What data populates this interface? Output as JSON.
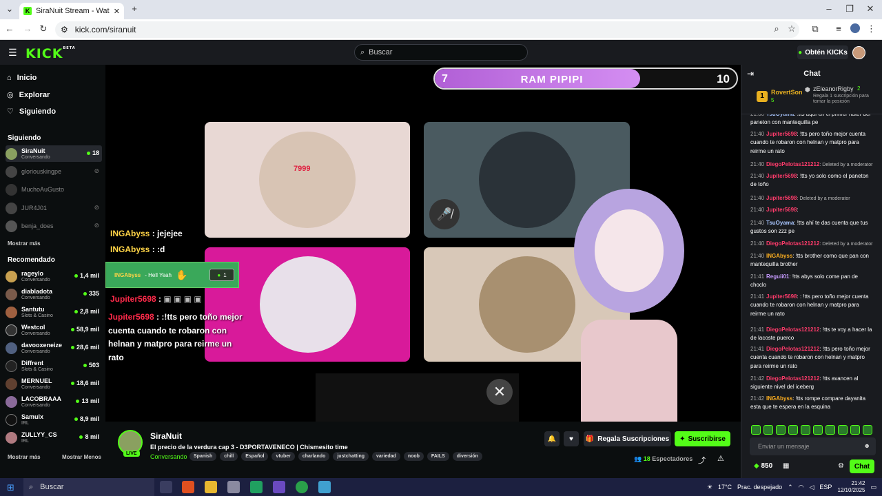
{
  "browser": {
    "tab_title": "SiraNuit Stream - Watch Live o",
    "url": "kick.com/siranuit"
  },
  "header": {
    "logo": "KICK",
    "logo_badge": "BETA",
    "search_placeholder": "Buscar",
    "kicks_button": "Obtén KICKs"
  },
  "sidebar": {
    "nav": [
      {
        "label": "Inicio",
        "icon": "home-icon"
      },
      {
        "label": "Explorar",
        "icon": "compass-icon"
      },
      {
        "label": "Siguiendo",
        "icon": "heart-icon"
      }
    ],
    "following_title": "Siguiendo",
    "following": [
      {
        "name": "SiraNuit",
        "category": "Conversando",
        "viewers": "18",
        "live": true
      },
      {
        "name": "gloriouskingpe",
        "category": "",
        "viewers": "",
        "live": false
      },
      {
        "name": "MuchoAuGusto",
        "category": "",
        "viewers": "",
        "live": false
      },
      {
        "name": "JUR4J01",
        "category": "",
        "viewers": "",
        "live": false
      },
      {
        "name": "benja_does",
        "category": "",
        "viewers": "",
        "live": false
      }
    ],
    "show_more_following": "Mostrar más",
    "recommended_title": "Recomendado",
    "recommended": [
      {
        "name": "rageylo",
        "category": "Conversando",
        "viewers": "1,4 mil"
      },
      {
        "name": "diabladota",
        "category": "Conversando",
        "viewers": "335"
      },
      {
        "name": "Santutu",
        "category": "Slots & Casino",
        "viewers": "2,8 mil"
      },
      {
        "name": "Westcol",
        "category": "Conversando",
        "viewers": "58,9 mil"
      },
      {
        "name": "davooxeneize",
        "category": "Conversando",
        "viewers": "28,6 mil"
      },
      {
        "name": "Diffrent",
        "category": "Slots & Casino",
        "viewers": "503"
      },
      {
        "name": "MERNUEL",
        "category": "Conversando",
        "viewers": "18,6 mil"
      },
      {
        "name": "LACOBRAAA",
        "category": "Conversando",
        "viewers": "13 mil"
      },
      {
        "name": "Samulx",
        "category": "IRL",
        "viewers": "8,9 mil"
      },
      {
        "name": "ZULLYY_CS",
        "category": "IRL",
        "viewers": "8 mil"
      }
    ],
    "show_more": "Mostrar más",
    "show_less": "Mostrar Menos"
  },
  "video": {
    "bar_left": "7",
    "bar_title": "RAM PIPIPI",
    "bar_right": "10",
    "bar_progress": 0.68,
    "tile_number": "7999",
    "overlay_lines": [
      {
        "user": "INGAbyss",
        "text": " : jejejee"
      },
      {
        "user": "INGAbyss",
        "text": " : :d"
      }
    ],
    "alert_user": "INGAbyss",
    "alert_text": "- Hell Yeah",
    "alert_count": "1",
    "jupiter_user": "Jupiter5698",
    "jupiter_msg_user": "Jupiter5698",
    "jupiter_msg": " : :!tts pero toño mejor cuenta cuando te robaron con helnan y matpro para reirme un rato"
  },
  "stream": {
    "channel": "SiraNuit",
    "live_badge": "LIVE",
    "title": "El precio de la verdura cap 3 - D3PORTAVENECO | Chismesito time",
    "category": "Conversando",
    "tags": [
      "Spanish",
      "chill",
      "Español",
      "vtuber",
      "charlando",
      "justchatting",
      "variedad",
      "noob",
      "FAILS",
      "diversión"
    ],
    "gift_button": "Regala Suscripciones",
    "subscribe_button": "Suscribirse",
    "viewers_count": "18",
    "viewers_label": "Espectadores"
  },
  "chat": {
    "title": "Chat",
    "pinned": {
      "top_user": "RovertSon",
      "top_count": "5",
      "rank": "1",
      "second_user": "zEleanorRigby",
      "second_count": "2",
      "note": "Regala 1 suscripción para tomar la posición"
    },
    "messages": [
      {
        "time": "21:38",
        "user": "TsuOyama",
        "color": "#a9c6ff",
        "text": ": !tts aquí en el primer hater del paneton con mantequilla pe",
        "deleted": false
      },
      {
        "time": "21:40",
        "user": "Jupiter5698",
        "color": "#ff3b6b",
        "text": ": !tts pero toño mejor cuenta cuando te robaron con helnan y matpro para reirme un rato",
        "deleted": false
      },
      {
        "time": "21:40",
        "user": "DiegoPelotas121212",
        "color": "#ff3b6b",
        "text": ": Deleted by a moderator",
        "deleted": true
      },
      {
        "time": "21:40",
        "user": "Jupiter5698",
        "color": "#ff3b6b",
        "text": ": !tts yo solo como el paneton de toño",
        "deleted": false
      },
      {
        "time": "21:40",
        "user": "Jupiter5698",
        "color": "#ff3b6b",
        "text": ": Deleted by a moderator",
        "deleted": true
      },
      {
        "time": "21:40",
        "user": "Jupiter5698",
        "color": "#ff3b6b",
        "text": ":",
        "deleted": false
      },
      {
        "time": "21:40",
        "user": "TsuOyama",
        "color": "#a9c6ff",
        "text": ": !tts ahí te das cuenta que tus gustos son zzz pe",
        "deleted": false
      },
      {
        "time": "21:40",
        "user": "DiegoPelotas121212",
        "color": "#ff3b6b",
        "text": ": Deleted by a moderator",
        "deleted": true
      },
      {
        "time": "21:40",
        "user": "INGAbyss",
        "color": "#ffb020",
        "text": ": !tts brother como que pan con mantequilla brother",
        "deleted": false
      },
      {
        "time": "21:41",
        "user": "Reguii01",
        "color": "#c79bff",
        "text": ": !tts abys solo come pan de choclo",
        "deleted": false
      },
      {
        "time": "21:41",
        "user": "Jupiter5698",
        "color": "#ff3b6b",
        "text": ": : !tts pero toño mejor cuenta cuando te robaron con helnan y matpro para reirme un rato",
        "deleted": false
      },
      {
        "time": "21:41",
        "user": "DiegoPelotas121212",
        "color": "#ff3b6b",
        "text": ": !tts te voy a hacer la de lacoste puerco",
        "deleted": false
      },
      {
        "time": "21:41",
        "user": "DiegoPelotas121212",
        "color": "#ff3b6b",
        "text": ": !tts pero toño mejor cuenta cuando te robaron con helnan y matpro para reirme un rato",
        "deleted": false
      },
      {
        "time": "21:42",
        "user": "DiegoPelotas121212",
        "color": "#ff3b6b",
        "text": ": !tts avancen al siguiente nivel del iceberg",
        "deleted": false
      },
      {
        "time": "21:42",
        "user": "INGAbyss",
        "color": "#ffb020",
        "text": ": !tts rompe compare dayanita esta que te espera en la esquina",
        "deleted": false
      }
    ],
    "input_placeholder": "Enviar un mensaje",
    "kicks_balance": "850",
    "send_button": "Chat"
  },
  "taskbar": {
    "search_placeholder": "Buscar",
    "weather": "17°C",
    "weather_desc": "Prac. despejado",
    "lang": "ESP",
    "time": "21:42",
    "date": "12/10/2025"
  },
  "colors": {
    "brand": "#53fc18",
    "bg": "#0b0e0f",
    "panel": "#191b1f"
  }
}
